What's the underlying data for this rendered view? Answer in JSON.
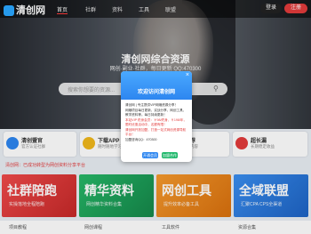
{
  "header": {
    "logo_text": "清创网",
    "nav": [
      "首页",
      "社群",
      "资料",
      "工具",
      "联盟"
    ],
    "login": "登录",
    "register": "注册"
  },
  "hero": {
    "title": "清创网综合资源",
    "subtitle": "网创·副业·社群，每日更新 QQ:470300",
    "search_placeholder": "搜索你想要的资源..."
  },
  "cards": [
    {
      "title": "清创暨官",
      "sub": "官方认证社群"
    },
    {
      "title": "下载APP",
      "sub": "随时随地学习"
    },
    {
      "title": "资源推荐",
      "sub": "精选优质内容"
    },
    {
      "title": "超长漏",
      "sub": "长期稳定收益"
    }
  ],
  "notice": "清创网：已成功转型为网创资料分享平台",
  "banners": [
    {
      "title": "社群陪跑",
      "sub": "实操落地全程陪跑",
      "color": "#e23b3b"
    },
    {
      "title": "精华资料",
      "sub": "网创精华资料合集",
      "color": "#1fa35a"
    },
    {
      "title": "网创工具",
      "sub": "提升效率必备工具",
      "color": "#f08a1c"
    },
    {
      "title": "全域联盟",
      "sub": "汇聚CPA CPS全渠道",
      "color": "#2b7fe0"
    }
  ],
  "bottom": [
    "项目教程",
    "网创课程",
    "工具软件",
    "资源合集"
  ],
  "modal": {
    "title": "欢迎访问清创网",
    "close": "×",
    "lines": [
      "清创网 | 专注提供VIP网赚资源分享！",
      "网赚项目每日更新，实战分享，网创工具，教学资料等。每日持续更新！",
      "本站VIP 终身会员：￥98/终身，￥198/年，限时优惠活动中，名额有限！",
      "清创网开放加盟，打造一站式网创资源导航平台！",
      "加盟咨询QQ：470300"
    ],
    "btn_primary": "开通会员",
    "btn_secondary": "加盟合作"
  }
}
